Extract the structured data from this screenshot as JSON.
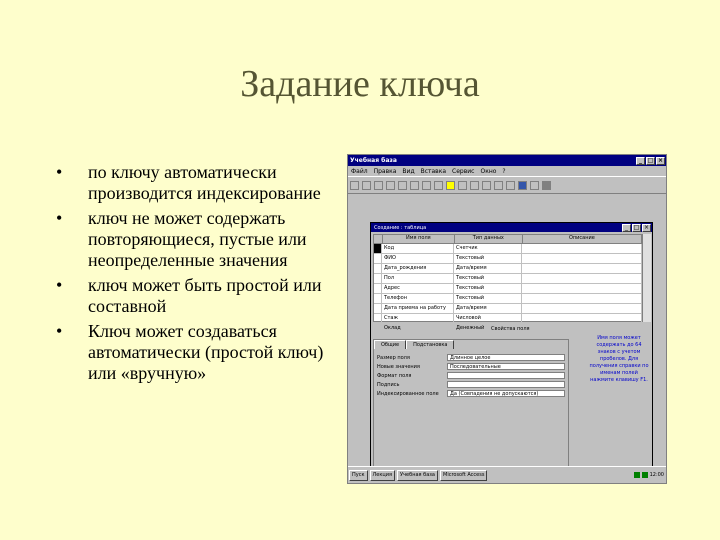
{
  "slide": {
    "title": "Задание ключа",
    "bullets": [
      {
        "mark": "•",
        "text": "по ключу автоматически производится индексирование"
      },
      {
        "mark": "•",
        "text": "ключ не может содержать повторяющиеся, пустые или неопределенные значения"
      },
      {
        "mark": "•",
        "text": "ключ может быть простой или составной"
      },
      {
        "mark": "•",
        "text": "Ключ может создаваться автоматически (простой ключ) или «вручную»"
      }
    ]
  },
  "window": {
    "title": "Учебная база",
    "menu": [
      "Файл",
      "Правка",
      "Вид",
      "Вставка",
      "Сервис",
      "Окно",
      "?"
    ],
    "buttons": {
      "min": "_",
      "max": "□",
      "close": "×"
    }
  },
  "table_window": {
    "title": "Создание : таблица",
    "columns": [
      "Имя поля",
      "Тип данных",
      "Описание"
    ],
    "rows": [
      {
        "name": "Код",
        "type": "Счетчик"
      },
      {
        "name": "ФИО",
        "type": "Текстовый"
      },
      {
        "name": "Дата_рождения",
        "type": "Дата/время"
      },
      {
        "name": "Пол",
        "type": "Текстовый"
      },
      {
        "name": "Адрес",
        "type": "Текстовый"
      },
      {
        "name": "Телефон",
        "type": "Текстовый"
      },
      {
        "name": "Дата приема на работу",
        "type": "Дата/время"
      },
      {
        "name": "Стаж",
        "type": "Числовой"
      },
      {
        "name": "Оклад",
        "type": "Денежный"
      }
    ],
    "section_label": "Свойства поля",
    "tabs": [
      "Общие",
      "Подстановка"
    ],
    "props": [
      {
        "label": "Размер поля",
        "value": "Длинное целое"
      },
      {
        "label": "Новые значения",
        "value": "Последовательные"
      },
      {
        "label": "Формат поля",
        "value": ""
      },
      {
        "label": "Подпись",
        "value": ""
      },
      {
        "label": "Индексированное поле",
        "value": "Да (Совпадения не допускаются)"
      }
    ],
    "hint": "Имя поля может содержать до 64 знаков с учетом пробелов. Для получения справки по именам полей нажмите клавишу F1."
  },
  "taskbar": {
    "start": "Пуск",
    "items": [
      "Лекция",
      "Учебная база",
      "Microsoft Access"
    ],
    "time": "12:00"
  }
}
